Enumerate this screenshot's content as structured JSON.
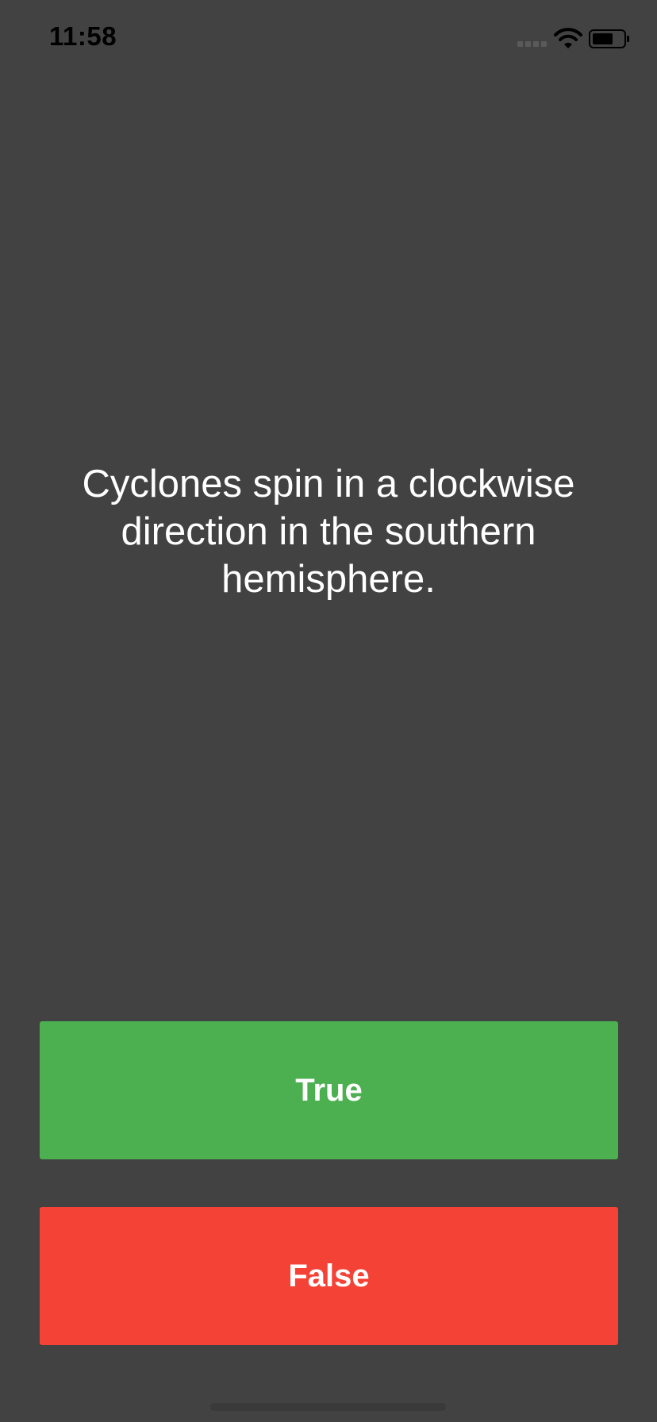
{
  "status_bar": {
    "time": "11:58",
    "icons": [
      "signal-icon",
      "wifi-icon",
      "battery-icon"
    ]
  },
  "question": {
    "text": "Cyclones spin in a clockwise direction in the southern hemisphere."
  },
  "answers": {
    "true_label": "True",
    "false_label": "False"
  },
  "colors": {
    "background": "#424242",
    "true_button": "#4caf50",
    "false_button": "#f44336",
    "text": "#ffffff",
    "status_text": "#000000"
  }
}
